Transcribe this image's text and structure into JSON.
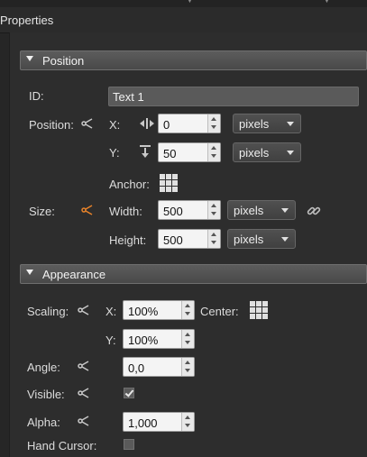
{
  "header": {
    "title": "Properties"
  },
  "sections": {
    "position": "Position",
    "appearance": "Appearance"
  },
  "id": {
    "label": "ID:",
    "value": "Text 1"
  },
  "position": {
    "label": "Position:",
    "x": {
      "label": "X:",
      "value": "0",
      "unit": "pixels"
    },
    "y": {
      "label": "Y:",
      "value": "50",
      "unit": "pixels"
    },
    "anchor": {
      "label": "Anchor:"
    }
  },
  "size": {
    "label": "Size:",
    "width": {
      "label": "Width:",
      "value": "500",
      "unit": "pixels"
    },
    "height": {
      "label": "Height:",
      "value": "500",
      "unit": "pixels"
    }
  },
  "scaling": {
    "label": "Scaling:",
    "x_label": "X:",
    "x_value": "100%",
    "y_label": "Y:",
    "y_value": "100%",
    "center_label": "Center:"
  },
  "angle": {
    "label": "Angle:",
    "value": "0,0"
  },
  "visible": {
    "label": "Visible:",
    "checked": true
  },
  "alpha": {
    "label": "Alpha:",
    "value": "1,000"
  },
  "hand_cursor": {
    "label": "Hand Cursor:",
    "checked": false
  },
  "colors": {
    "accent_orange": "#e8832a",
    "icon_gray": "#c8c8c8"
  }
}
